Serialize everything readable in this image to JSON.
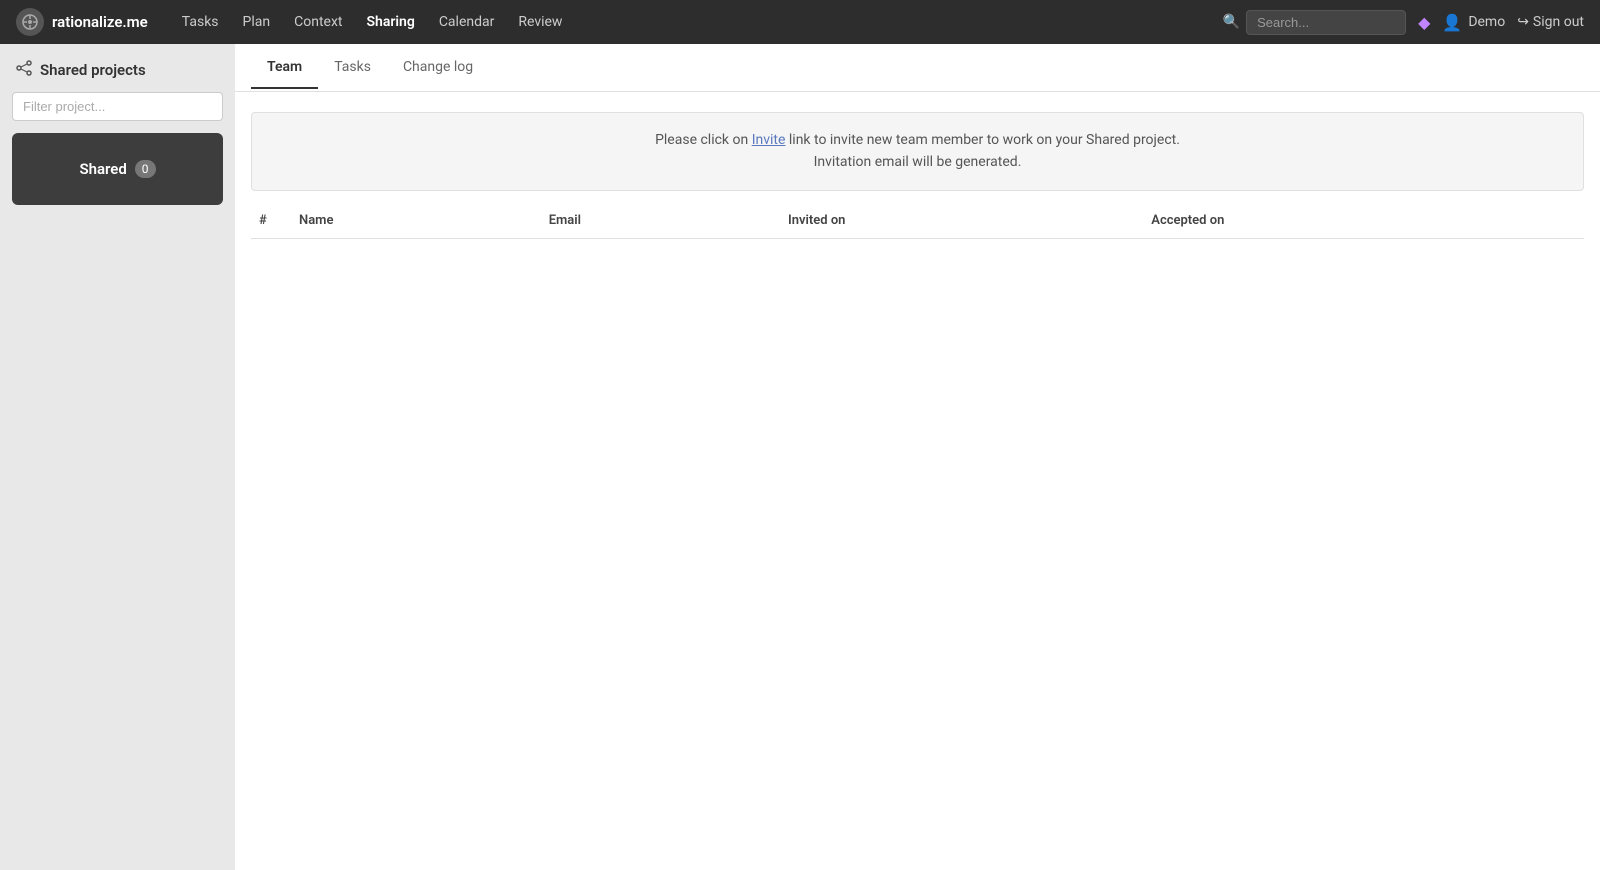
{
  "app": {
    "logo_text": "rationalize.me",
    "logo_icon": "⬡"
  },
  "nav": {
    "links": [
      {
        "label": "Tasks",
        "active": false
      },
      {
        "label": "Plan",
        "active": false
      },
      {
        "label": "Context",
        "active": false
      },
      {
        "label": "Sharing",
        "active": true
      },
      {
        "label": "Calendar",
        "active": false
      },
      {
        "label": "Review",
        "active": false
      }
    ],
    "search_placeholder": "Search...",
    "user_label": "Demo",
    "signout_label": "Sign out"
  },
  "sidebar": {
    "header": "Shared projects",
    "filter_placeholder": "Filter project...",
    "project": {
      "label": "Shared",
      "badge": "0"
    }
  },
  "tabs": [
    {
      "label": "Team",
      "active": true
    },
    {
      "label": "Tasks",
      "active": false
    },
    {
      "label": "Change log",
      "active": false
    }
  ],
  "team_tab": {
    "banner_text_before": "Please click on ",
    "invite_link_text": "Invite",
    "banner_text_after": " link to invite new team member to work on your Shared project.",
    "banner_line2": "Invitation email will be generated.",
    "table_columns": [
      "#",
      "Name",
      "Email",
      "Invited on",
      "Accepted on"
    ],
    "rows": []
  }
}
